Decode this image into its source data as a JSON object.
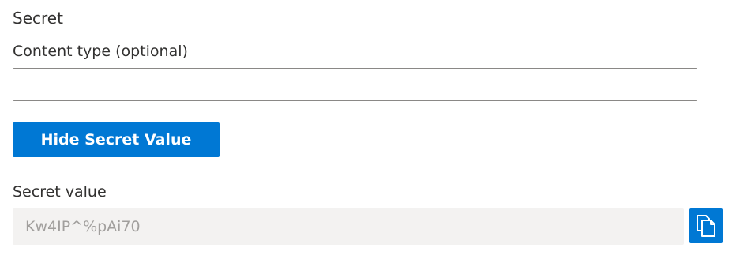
{
  "secret_section": {
    "title": "Secret"
  },
  "content_type": {
    "label": "Content type (optional)",
    "value": "",
    "placeholder": ""
  },
  "toggle_button": {
    "label": "Hide Secret Value"
  },
  "secret_value": {
    "label": "Secret value",
    "value": "Kw4IP^%pAi70"
  },
  "copy_button": {
    "icon": "copy-icon"
  },
  "colors": {
    "accent": "#0078d4",
    "text": "#323130",
    "readonly_bg": "#f3f2f1",
    "readonly_text": "#a19f9d",
    "input_border": "#8a8886"
  }
}
